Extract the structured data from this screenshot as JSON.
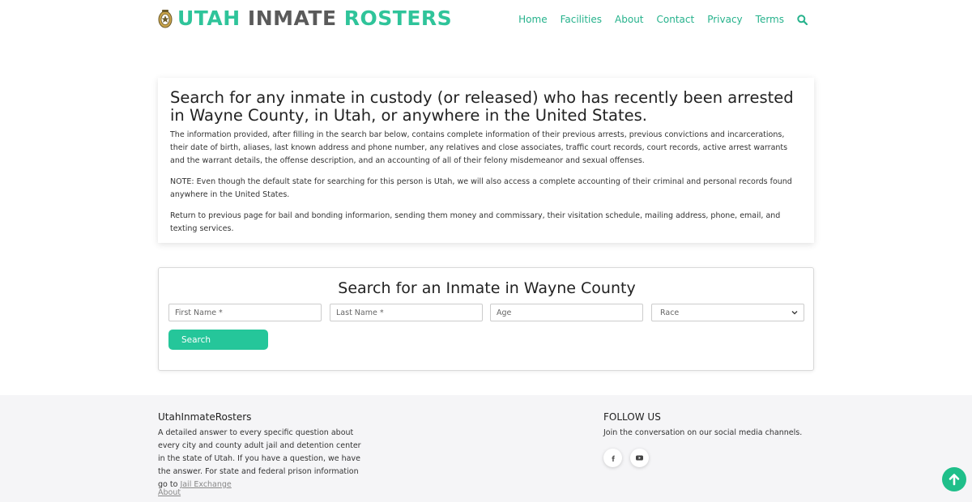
{
  "header": {
    "logo_word1": "UTAH",
    "logo_word2": "INMATE",
    "logo_word3": "ROSTERS",
    "nav": [
      "Home",
      "Facilities",
      "About",
      "Contact",
      "Privacy",
      "Terms"
    ],
    "search_icon": "search-icon"
  },
  "intro": {
    "heading": "Search for any inmate in custody (or released) who has recently been arrested in Wayne County, in Utah, or anywhere in the United States.",
    "p1": "The information provided, after filling in the search bar below, contains complete information of their previous arrests, previous convictions and incarcerations, their date of birth, aliases, last known address and phone number, any relatives  and close associates, traffic court records, court records, active arrest warrants and the warrant details, the offense description, and an accounting of all of their felony misdemeanor and sexual offenses.",
    "p2": "NOTE: Even though the default state for searching for this person is Utah, we will also access a complete accounting of their criminal and personal records found anywhere in the United States.",
    "p3": "Return to previous page for bail and bonding informarion, sending them money and commissary, their visitation schedule, mailing address, phone, email, and texting services."
  },
  "search": {
    "title": "Search for an Inmate in Wayne County",
    "first_name_placeholder": "First Name *",
    "last_name_placeholder": "Last Name *",
    "age_placeholder": "Age",
    "race_selected": "Race",
    "button_label": "Search"
  },
  "footer": {
    "brand_title": "UtahInmateRosters",
    "brand_text": "A detailed answer to every specific question about every city and county adult jail and detention center in the state of Utah. If you have a question, we have the answer. For state and federal prison information go to",
    "jail_exchange_link": "Jail Exchange",
    "about_link": "About",
    "follow_title": "FOLLOW US",
    "follow_text": "Join the conversation on our social media channels.",
    "social_icons": [
      "facebook-icon",
      "youtube-icon"
    ]
  },
  "colors": {
    "accent": "#2fc49a",
    "nav_link": "#26b28c",
    "footer_bg": "#f5f5f7"
  }
}
